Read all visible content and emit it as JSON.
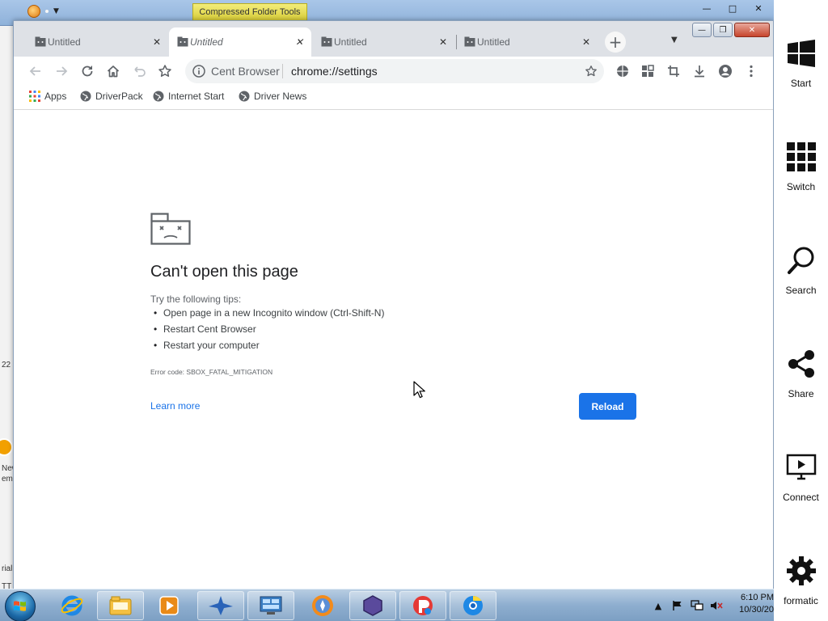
{
  "background_window": {
    "contextual_tab": "Compressed Folder Tools",
    "left_fragments": [
      "22",
      "New",
      "em:",
      "rial",
      "TT"
    ]
  },
  "browser": {
    "tabs": [
      {
        "title": "Untitled",
        "active": false,
        "icon": "sad-page-icon"
      },
      {
        "title": "Untitled",
        "active": true,
        "icon": "sad-page-icon"
      },
      {
        "title": "Untitled",
        "active": false,
        "icon": "sad-page-icon"
      },
      {
        "title": "Untitled",
        "active": false,
        "icon": "sad-page-icon"
      }
    ],
    "toolbar": {
      "site_name": "Cent Browser",
      "url": "chrome://settings"
    },
    "bookmarks": [
      {
        "label": "Apps",
        "icon": "apps-grid-icon"
      },
      {
        "label": "DriverPack",
        "icon": "globe-icon"
      },
      {
        "label": "Internet Start",
        "icon": "globe-icon"
      },
      {
        "label": "Driver News",
        "icon": "globe-icon"
      }
    ],
    "error": {
      "title": "Can't open this page",
      "tips_heading": "Try the following tips:",
      "tips": [
        "Open page in a new Incognito window (Ctrl-Shift-N)",
        "Restart Cent Browser",
        "Restart your computer"
      ],
      "error_code": "Error code: SBOX_FATAL_MITIGATION",
      "learn_more": "Learn more",
      "reload": "Reload"
    }
  },
  "charms": [
    {
      "label": "Start",
      "icon": "windows-logo-icon"
    },
    {
      "label": "Switch",
      "icon": "grid-tiles-icon"
    },
    {
      "label": "Search",
      "icon": "magnifier-icon"
    },
    {
      "label": "Share",
      "icon": "share-nodes-icon"
    },
    {
      "label": "Connect",
      "icon": "monitor-play-icon"
    },
    {
      "label": "formatic",
      "icon": "gear-icon"
    }
  ],
  "taskbar": {
    "apps": [
      "internet-explorer",
      "file-explorer",
      "media-player",
      "bird-app",
      "control-panel",
      "firefox-style-browser",
      "hexagon-app",
      "pinball-app",
      "cent-browser"
    ],
    "clock_time": "6:10 PM",
    "clock_date": "10/30/20"
  },
  "colors": {
    "accent_blue": "#1a73e8",
    "tabstrip": "#dee1e6"
  }
}
